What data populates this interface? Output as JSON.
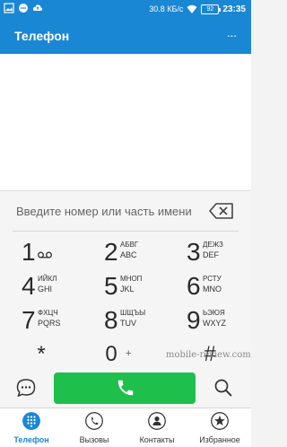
{
  "status_bar": {
    "net_speed": "30.8 КБ/с",
    "battery": "92",
    "time": "23:35"
  },
  "app_bar": {
    "title": "Телефон",
    "more_label": "···"
  },
  "dialer": {
    "number_placeholder": "Введите номер или часть имени",
    "keys": [
      {
        "digit": "1",
        "line1": "",
        "line2": ""
      },
      {
        "digit": "2",
        "line1": "АБВГ",
        "line2": "ABC"
      },
      {
        "digit": "3",
        "line1": "ДЕЖЗ",
        "line2": "DEF"
      },
      {
        "digit": "4",
        "line1": "ИЙКЛ",
        "line2": "GHI"
      },
      {
        "digit": "5",
        "line1": "МНОП",
        "line2": "JKL"
      },
      {
        "digit": "6",
        "line1": "РСТУ",
        "line2": "MNO"
      },
      {
        "digit": "7",
        "line1": "ФХЦЧ",
        "line2": "PQRS"
      },
      {
        "digit": "8",
        "line1": "ШЩЪЫ",
        "line2": "TUV"
      },
      {
        "digit": "9",
        "line1": "ЬЭЮЯ",
        "line2": "WXYZ"
      }
    ],
    "star": "*",
    "zero": "0",
    "plus": "+",
    "hash": "#"
  },
  "watermark": "mobile-review.com",
  "bottom_nav": [
    {
      "label": "Телефон",
      "icon": "dialpad-icon",
      "active": true
    },
    {
      "label": "Вызовы",
      "icon": "phone-history-icon",
      "active": false
    },
    {
      "label": "Контакты",
      "icon": "contact-icon",
      "active": false
    },
    {
      "label": "Избранное",
      "icon": "star-icon",
      "active": false
    }
  ],
  "colors": {
    "primary": "#1a87d4",
    "call_green": "#1fbf4c"
  }
}
